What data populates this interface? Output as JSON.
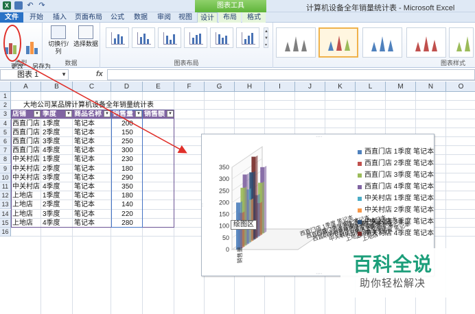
{
  "window": {
    "title": "计算机设备全年销量统计表 - Microsoft Excel",
    "context_group": "图表工具"
  },
  "tabs": [
    "文件",
    "开始",
    "插入",
    "页面布局",
    "公式",
    "数据",
    "审阅",
    "视图",
    "设计",
    "布局",
    "格式"
  ],
  "ribbon": {
    "type_group": {
      "label": "类型",
      "change_type": "更改\n图表类型",
      "save_template": "另存为\n模板"
    },
    "data_group": {
      "label": "数据",
      "switch_row_col": "切换行/列",
      "select_data": "选择数据"
    },
    "layout_group": {
      "label": "图表布局"
    },
    "style_group": {
      "label": "图表样式"
    }
  },
  "formula_bar": {
    "name_box": "图表 1",
    "fx": "fx",
    "formula": ""
  },
  "columns": [
    "A",
    "B",
    "C",
    "D",
    "E",
    "F",
    "G",
    "H",
    "I",
    "J",
    "K",
    "L",
    "M",
    "N",
    "O"
  ],
  "rows": [
    "1",
    "2",
    "3",
    "4",
    "5",
    "6",
    "7",
    "8",
    "9",
    "10",
    "11",
    "12",
    "13",
    "14",
    "15",
    "16"
  ],
  "sheet": {
    "title": "大地公司某品牌计算机设备全年销量统计表",
    "headers": [
      "店铺",
      "季度",
      "商品名称",
      "销售量",
      "销售额"
    ],
    "data": [
      [
        "西直门店",
        "1季度",
        "笔记本",
        "200"
      ],
      [
        "西直门店",
        "2季度",
        "笔记本",
        "150"
      ],
      [
        "西直门店",
        "3季度",
        "笔记本",
        "250"
      ],
      [
        "西直门店",
        "4季度",
        "笔记本",
        "300"
      ],
      [
        "中关村店",
        "1季度",
        "笔记本",
        "230"
      ],
      [
        "中关村店",
        "2季度",
        "笔记本",
        "180"
      ],
      [
        "中关村店",
        "3季度",
        "笔记本",
        "290"
      ],
      [
        "中关村店",
        "4季度",
        "笔记本",
        "350"
      ],
      [
        "上地店",
        "1季度",
        "笔记本",
        "180"
      ],
      [
        "上地店",
        "2季度",
        "笔记本",
        "140"
      ],
      [
        "上地店",
        "3季度",
        "笔记本",
        "220"
      ],
      [
        "上地店",
        "4季度",
        "笔记本",
        "280"
      ]
    ]
  },
  "chart": {
    "tooltip": "绘图区",
    "y_ticks": [
      "350",
      "300",
      "250",
      "200",
      "150",
      "100",
      "50",
      "0"
    ],
    "x_label": "销售量",
    "legend": [
      {
        "label": "西直门店 1季度 笔记本",
        "color": "#4f81bd"
      },
      {
        "label": "西直门店 2季度 笔记本",
        "color": "#c0504d"
      },
      {
        "label": "西直门店 3季度 笔记本",
        "color": "#9bbb59"
      },
      {
        "label": "西直门店 4季度 笔记本",
        "color": "#8064a2"
      },
      {
        "label": "中关村店 1季度 笔记本",
        "color": "#4bacc6"
      },
      {
        "label": "中关村店 2季度 笔记本",
        "color": "#f79646"
      },
      {
        "label": "中关村店 3季度 笔记本",
        "color": "#2c4d75"
      },
      {
        "label": "中关村店 4季度 笔记本",
        "color": "#772c2a"
      }
    ]
  },
  "chart_data": {
    "type": "bar",
    "categories": [
      "销售量"
    ],
    "series": [
      {
        "name": "西直门店 1季度 笔记本",
        "values": [
          200
        ]
      },
      {
        "name": "西直门店 2季度 笔记本",
        "values": [
          150
        ]
      },
      {
        "name": "西直门店 3季度 笔记本",
        "values": [
          250
        ]
      },
      {
        "name": "西直门店 4季度 笔记本",
        "values": [
          300
        ]
      },
      {
        "name": "中关村店 1季度 笔记本",
        "values": [
          230
        ]
      },
      {
        "name": "中关村店 2季度 笔记本",
        "values": [
          180
        ]
      },
      {
        "name": "中关村店 3季度 笔记本",
        "values": [
          290
        ]
      },
      {
        "name": "中关村店 4季度 笔记本",
        "values": [
          350
        ]
      },
      {
        "name": "上地店 1季度 笔记本",
        "values": [
          180
        ]
      },
      {
        "name": "上地店 2季度 笔记本",
        "values": [
          140
        ]
      },
      {
        "name": "上地店 3季度 笔记本",
        "values": [
          220
        ]
      },
      {
        "name": "上地店 4季度 笔记本",
        "values": [
          280
        ]
      }
    ],
    "ylim": [
      0,
      350
    ],
    "y_ticks": [
      0,
      50,
      100,
      150,
      200,
      250,
      300,
      350
    ],
    "legend_position": "right",
    "projection": "3d"
  },
  "watermark": {
    "title": "百科全说",
    "subtitle": "助你轻松解决"
  },
  "colors": {
    "accent": "#2a72c6",
    "context": "#5fb43a",
    "table_header": "#8064a2",
    "annotation": "#e0302a",
    "watermark": "#1c9e7a"
  }
}
